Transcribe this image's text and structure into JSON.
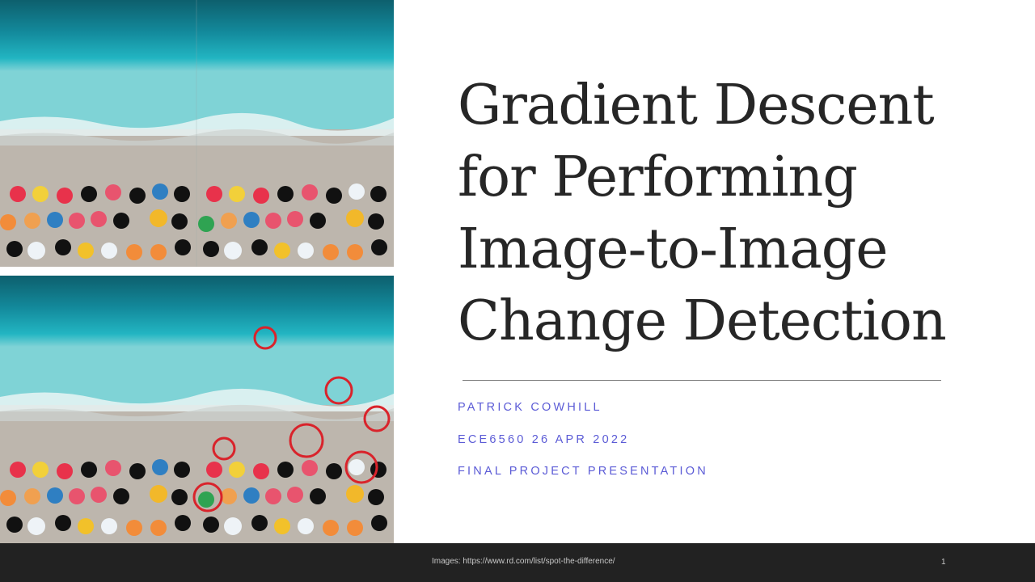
{
  "slide": {
    "title_lines": [
      "Gradient Descent",
      "for Performing",
      "Image-to-Image",
      "Change Detection"
    ],
    "author": "PATRICK COWHILL",
    "course_date": "ECE6560 26 APR 2022",
    "subtitle": "FINAL PROJECT PRESENTATION",
    "footer_text": "Images: https://www.rd.com/list/spot-the-difference/",
    "page_number": "1"
  },
  "colors": {
    "title": "#262626",
    "subtitle": "#5b5bd6",
    "footer_bg": "#222222",
    "ocean": "#1aa3b4",
    "sand": "#b9b2a8",
    "circle": "#d9232b"
  },
  "images": {
    "top_panel_icon": "beach-aerial-photo-icon",
    "bottom_panel_icon": "beach-aerial-photo-with-difference-circles-icon",
    "difference_circle_count": 7
  }
}
